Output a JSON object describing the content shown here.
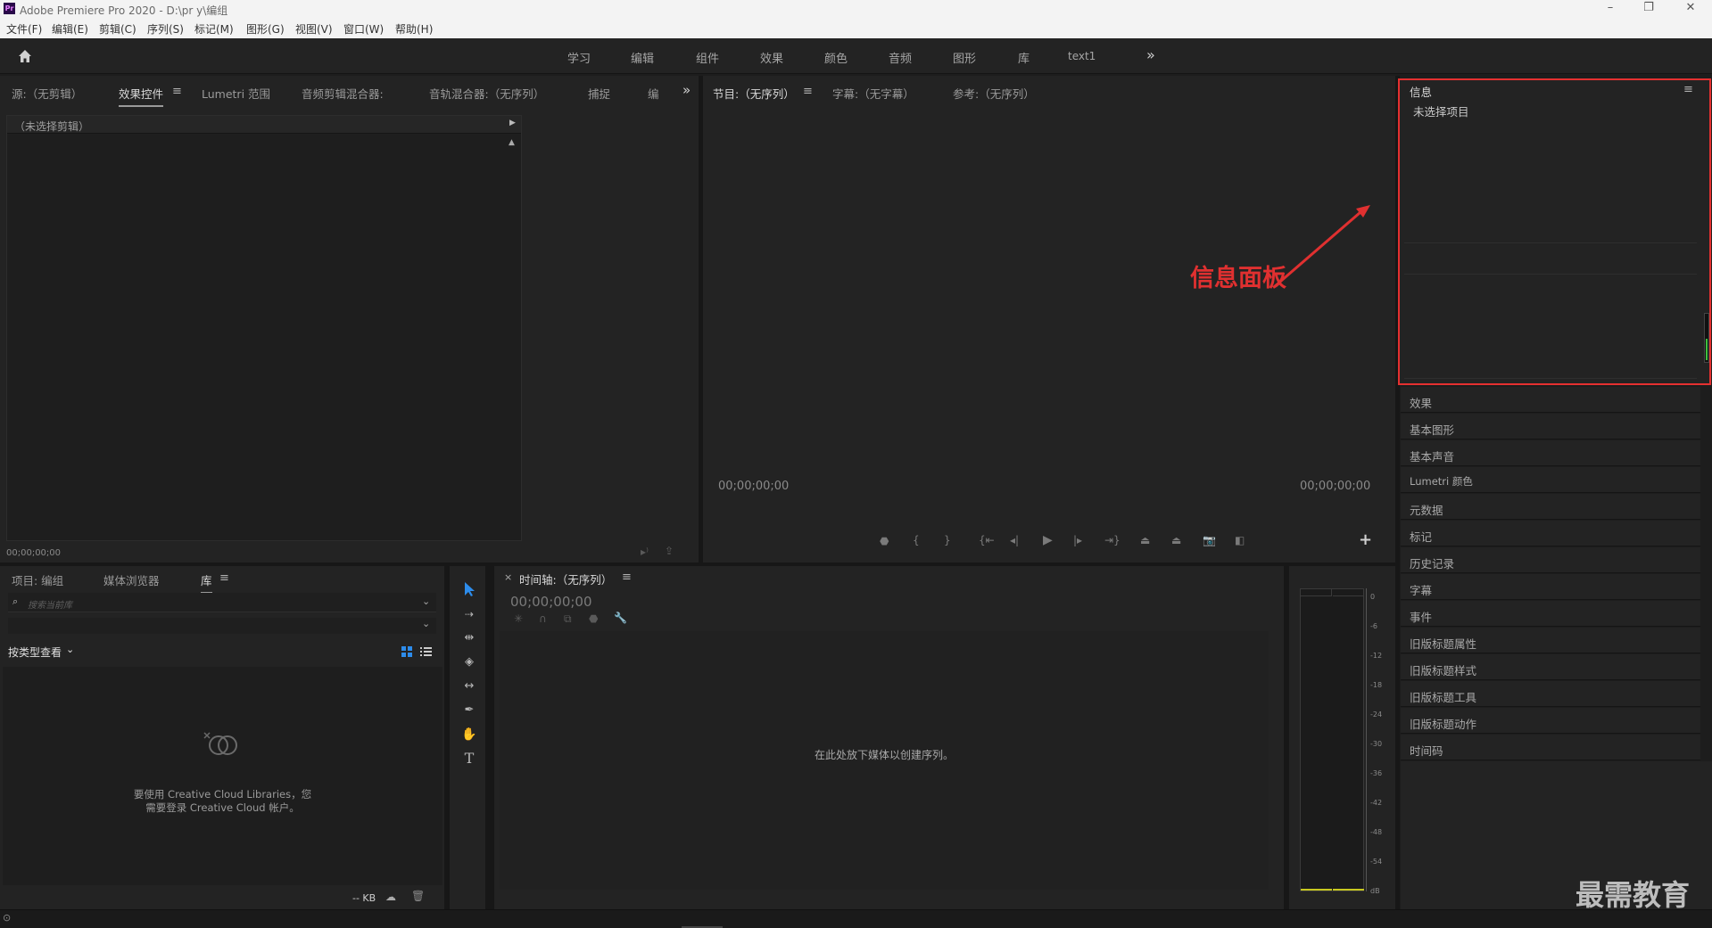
{
  "window": {
    "title": "Adobe Premiere Pro 2020 - D:\\pr y\\编组",
    "minimize": "–",
    "restore": "❐",
    "close": "✕"
  },
  "menu": [
    "文件(F)",
    "编辑(E)",
    "剪辑(C)",
    "序列(S)",
    "标记(M)",
    "图形(G)",
    "视图(V)",
    "窗口(W)",
    "帮助(H)"
  ],
  "workspaces": [
    "学习",
    "编辑",
    "组件",
    "效果",
    "颜色",
    "音频",
    "图形",
    "库",
    "text1"
  ],
  "workspace_more": "»",
  "source_panel": {
    "tabs": [
      "源:（无剪辑）",
      "效果控件",
      "Lumetri 范围",
      "音频剪辑混合器:",
      "音轨混合器:（无序列）",
      "捕捉",
      "编"
    ],
    "menu_icon": "≡",
    "more": "»",
    "clip_header": "（未选择剪辑）",
    "timecode": "00;00;00;00"
  },
  "program_panel": {
    "tabs": [
      "节目:（无序列）",
      "字幕:（无字幕）",
      "参考:（无序列）"
    ],
    "menu_icon": "≡",
    "timecode_left": "00;00;00;00",
    "timecode_right": "00;00;00;00",
    "add_button": "+"
  },
  "info_panel": {
    "title": "信息",
    "menu_icon": "≡",
    "status": "未选择项目"
  },
  "annotation": {
    "label": "信息面板",
    "color": "#e03030"
  },
  "right_stack": [
    "效果",
    "基本图形",
    "基本声音",
    "Lumetri 颜色",
    "元数据",
    "标记",
    "历史记录",
    "字幕",
    "事件",
    "旧版标题属性",
    "旧版标题样式",
    "旧版标题工具",
    "旧版标题动作",
    "时间码"
  ],
  "project_panel": {
    "tabs": [
      "项目: 编组",
      "媒体浏览器",
      "库"
    ],
    "menu_icon": "≡",
    "search_placeholder": "搜索当前库",
    "view_mode": "按类型查看",
    "cc_message_line1": "要使用 Creative Cloud Libraries，您",
    "cc_message_line2": "需要登录 Creative Cloud 帐户。",
    "storage": "-- KB"
  },
  "timeline_panel": {
    "close": "×",
    "title": "时间轴:（无序列）",
    "menu_icon": "≡",
    "timecode": "00;00;00;00",
    "empty_message": "在此处放下媒体以创建序列。"
  },
  "audio_meter": {
    "ticks": [
      "0",
      "-6",
      "-12",
      "-18",
      "-24",
      "-30",
      "-36",
      "-42",
      "-48",
      "-54",
      "dB"
    ]
  },
  "watermark": "最需教育",
  "colors": {
    "accent_blue": "#2d8ceb",
    "highlight_red": "#e53030",
    "meter_green": "#3fbf3f"
  }
}
